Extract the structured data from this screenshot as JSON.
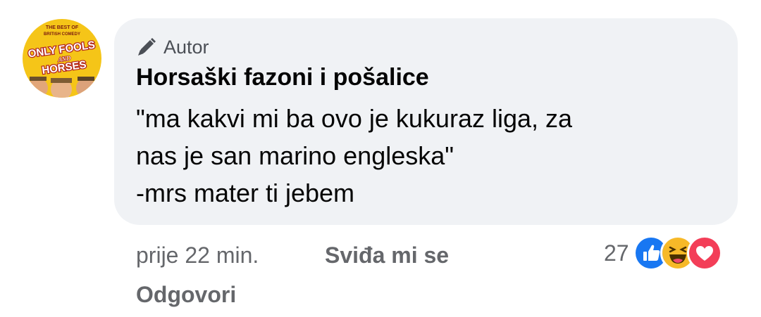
{
  "avatar": {
    "title_top": "THE BEST OF",
    "title_mid": "BRITISH COMEDY",
    "logo_line1": "ONLY FOOLS",
    "logo_line2": "AND",
    "logo_line3": "HORSES",
    "background": "#f5c518"
  },
  "comment": {
    "badge_label": "Autor",
    "badge_icon": "pencil-icon",
    "author": "Horsaški fazoni i pošalice",
    "lines": [
      "\"ma kakvi mi ba ovo je kukuraz liga, za",
      "nas je san marino engleska\"",
      "-mrs mater ti jebem"
    ]
  },
  "meta": {
    "time": "prije 22 min.",
    "like_label": "Sviđa mi se",
    "reply_label": "Odgovori"
  },
  "reactions": {
    "count": "27",
    "icons": [
      "like-icon",
      "haha-icon",
      "love-icon"
    ],
    "colors": {
      "like": "#1877f2",
      "haha": "#f7b928",
      "love": "#f33e58"
    }
  }
}
